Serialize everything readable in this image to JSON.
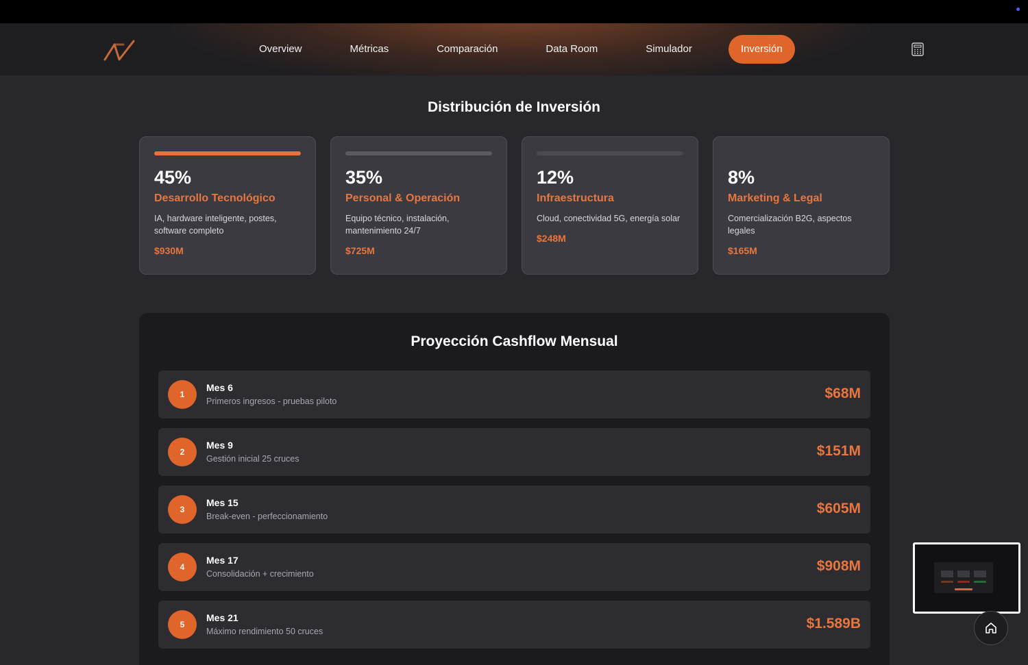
{
  "nav": {
    "links": [
      "Overview",
      "Métricas",
      "Comparación",
      "Data Room",
      "Simulador"
    ],
    "active": "Inversión"
  },
  "icons": {
    "logo": "logo-icon",
    "calculator": "calculator-icon",
    "home": "home-icon"
  },
  "colors": {
    "accent": "#e0652b",
    "accent_text": "#e8763e",
    "background": "#28282c",
    "card": "#3a3a40",
    "panel": "#1b1b1e"
  },
  "distribution": {
    "title": "Distribución de Inversión",
    "cards": [
      {
        "percent": "45%",
        "percent_value": 45,
        "category": "Desarrollo Tecnológico",
        "description": "IA, hardware inteligente, postes, software completo",
        "amount": "$930M"
      },
      {
        "percent": "35%",
        "percent_value": 35,
        "category": "Personal & Operación",
        "description": "Equipo técnico, instalación, mantenimiento 24/7",
        "amount": "$725M"
      },
      {
        "percent": "12%",
        "percent_value": 12,
        "category": "Infraestructura",
        "description": "Cloud, conectividad 5G, energía solar",
        "amount": "$248M"
      },
      {
        "percent": "8%",
        "percent_value": 8,
        "category": "Marketing & Legal",
        "description": "Comercialización B2G, aspectos legales",
        "amount": "$165M"
      }
    ]
  },
  "cashflow": {
    "title": "Proyección Cashflow Mensual",
    "rows": [
      {
        "num": "1",
        "title": "Mes 6",
        "subtitle": "Primeros ingresos - pruebas piloto",
        "amount": "$68M"
      },
      {
        "num": "2",
        "title": "Mes 9",
        "subtitle": "Gestión inicial 25 cruces",
        "amount": "$151M"
      },
      {
        "num": "3",
        "title": "Mes 15",
        "subtitle": "Break-even - perfeccionamiento",
        "amount": "$605M"
      },
      {
        "num": "4",
        "title": "Mes 17",
        "subtitle": "Consolidación + crecimiento",
        "amount": "$908M"
      },
      {
        "num": "5",
        "title": "Mes 21",
        "subtitle": "Máximo rendimiento 50 cruces",
        "amount": "$1.589B"
      }
    ]
  }
}
